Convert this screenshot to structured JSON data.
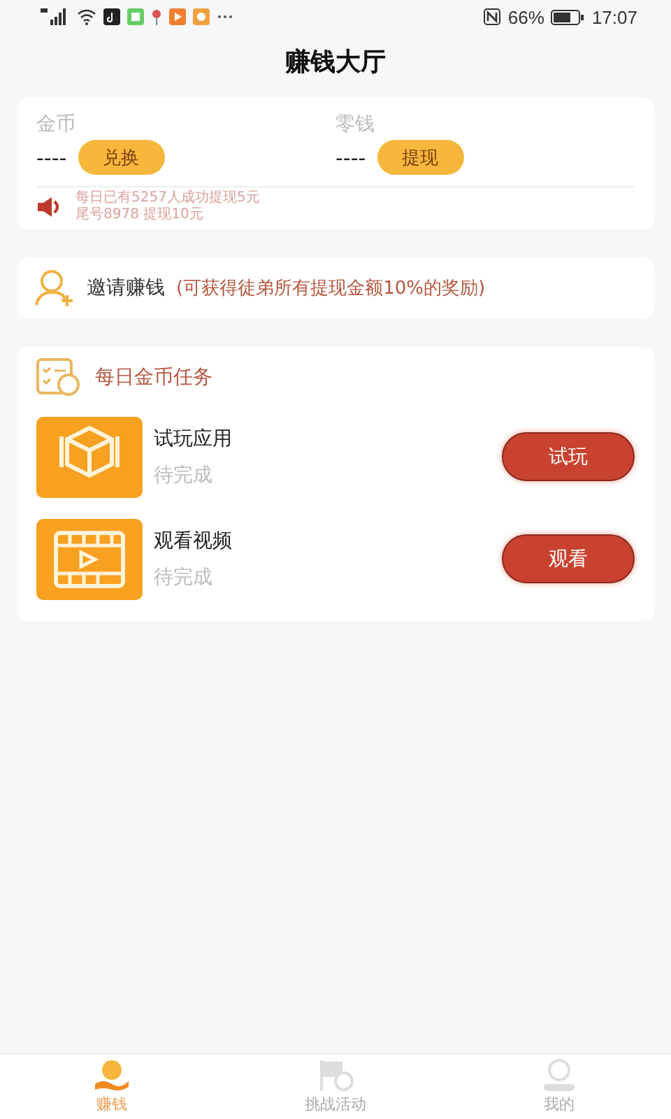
{
  "status_bar": {
    "battery": "66%",
    "time": "17:07"
  },
  "header": {
    "title": "赚钱大厅"
  },
  "wallet": {
    "accounts": [
      {
        "label": "金币",
        "value": "----",
        "button": "兑换"
      },
      {
        "label": "零钱",
        "value": "----",
        "button": "提现"
      }
    ],
    "notices": [
      "每日已有5257人成功提现5元",
      "尾号8978 提现10元"
    ]
  },
  "invite": {
    "label": "邀请赚钱",
    "note": "(可获得徒弟所有提现金额10%的奖励)"
  },
  "tasks": {
    "title": "每日金币任务",
    "items": [
      {
        "kind": "app",
        "name": "试玩应用",
        "status": "待完成",
        "button": "试玩"
      },
      {
        "kind": "video",
        "name": "观看视频",
        "status": "待完成",
        "button": "观看"
      }
    ]
  },
  "tab_bar": [
    {
      "kind": "earn",
      "label": "赚钱",
      "selected": true
    },
    {
      "kind": "flag",
      "label": "挑战活动",
      "selected": false
    },
    {
      "kind": "user",
      "label": "我的",
      "selected": false
    }
  ]
}
